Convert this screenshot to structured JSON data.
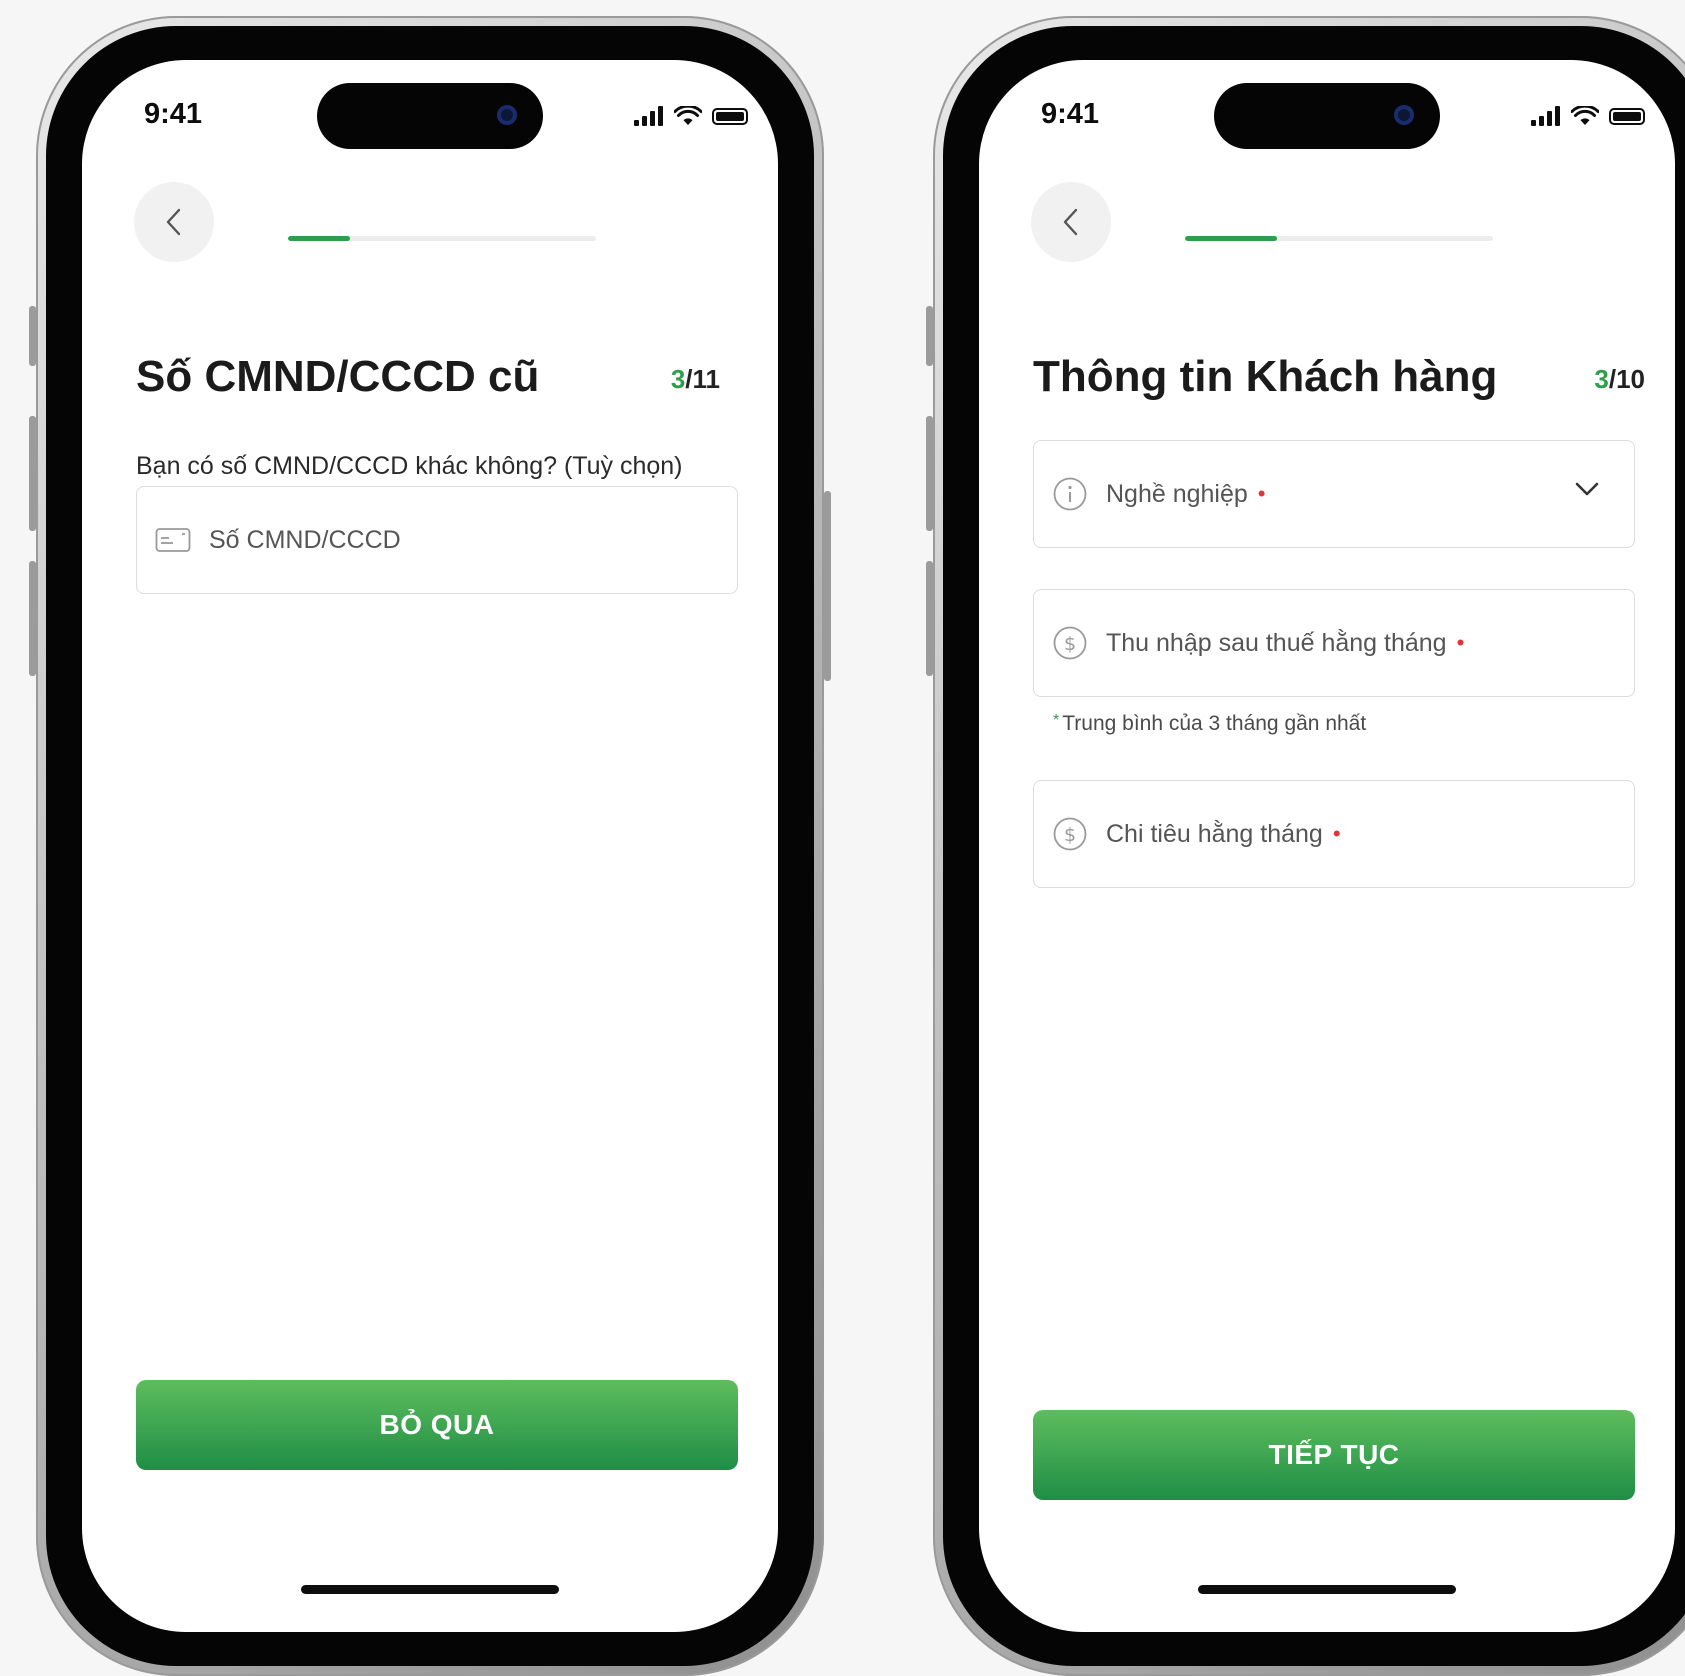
{
  "left_screen": {
    "time": "9:41",
    "progress": 0.2,
    "title": "Số CMND/CCCD cũ",
    "step_current": "3",
    "step_total": "/11",
    "subtitle": "Bạn có số CMND/CCCD khác không? (Tuỳ chọn)",
    "id_field": {
      "label": "Số CMND/CCCD",
      "icon": "id-card-icon"
    },
    "button": "BỎ QUA"
  },
  "right_screen": {
    "time": "9:41",
    "progress": 0.3,
    "title": "Thông tin Khách hàng",
    "step_current": "3",
    "step_total": "/10",
    "fields": [
      {
        "label": "Nghề nghiệp",
        "icon": "info-icon",
        "required": "•",
        "dropdown": true
      },
      {
        "label": "Thu nhập sau thuế hằng tháng",
        "icon": "dollar-icon",
        "required": "•"
      },
      {
        "label": "Chi tiêu hằng tháng",
        "icon": "dollar-icon",
        "required": "•"
      }
    ],
    "income_hint": "Trung bình của 3 tháng gần nhất",
    "hint_marker": "*",
    "button": "TIẾP TỤC"
  },
  "colors": {
    "accent": "#2e9e4b",
    "required": "#e0343a",
    "button_top": "#5ebd5d",
    "button_bottom": "#1f8e46"
  }
}
